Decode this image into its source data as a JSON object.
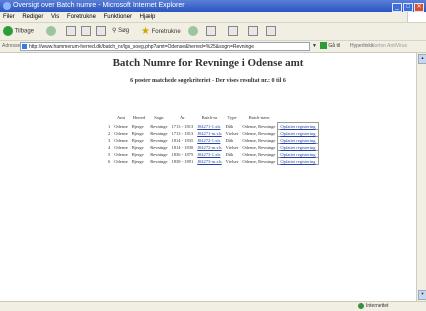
{
  "window": {
    "title": "Oversigt over Batch numre - Microsoft Internet Explorer",
    "buttons": {
      "minimize": "_",
      "maximize": "□",
      "close": "✕"
    }
  },
  "menubar": {
    "items": [
      "Filer",
      "Rediger",
      "Vis",
      "Foretrukne",
      "Funktioner",
      "Hjælp"
    ]
  },
  "toolbar": {
    "back_label": "Tilbage",
    "search_label": "Søg",
    "favorites_label": "Foretrukne"
  },
  "address": {
    "label": "Adresse",
    "url": "http://www.hammerum-herred.dk/batch_nr/lgs_soeg.php?amt=Odense&herred=%25&sogn=Revninge",
    "go_label": "Gå til",
    "links_label": "Hyperlinks",
    "norton_label": "Norton AntiVirus"
  },
  "page": {
    "heading": "Batch Numre for Revninge i Odense amt",
    "subheading": "6 poster matchede søgekriteriet - Der vises resultat nr.: 0 til 6"
  },
  "table": {
    "headers": [
      "",
      "Amt",
      "Herred",
      "Sogn",
      "År",
      "Batch-nr",
      "Type",
      "Batch-navn",
      ""
    ],
    "rows": [
      [
        "1",
        "Odense",
        "Bjerge",
        "Revninge",
        "1713 - 1813",
        "J04271-1.xls",
        "Dåb",
        "Odense, Revninge",
        "Opfattet registering"
      ],
      [
        "2",
        "Odense",
        "Bjerge",
        "Revninge",
        "1713 - 1813",
        "J04271-m.xls",
        "Vielser",
        "Odense, Revninge",
        "Opfattet registering"
      ],
      [
        "3",
        "Odense",
        "Bjerge",
        "Revninge",
        "1814 - 1835",
        "J04272-1.xls",
        "Dåb",
        "Odense, Revninge",
        "Opfattet registering"
      ],
      [
        "4",
        "Odense",
        "Bjerge",
        "Revninge",
        "1814 - 1830",
        "J04272-m.xls",
        "Vielser",
        "Odense, Revninge",
        "Opfattet registering"
      ],
      [
        "5",
        "Odense",
        "Bjerge",
        "Revninge",
        "1836 - 1875",
        "J04273-1.xls",
        "Dåb",
        "Odense, Revninge",
        "Opfattet registering"
      ],
      [
        "6",
        "Odense",
        "Bjerge",
        "Revninge",
        "1838 - 1891",
        "J04273-m.xls",
        "Vielser",
        "Odense, Revninge",
        "Opfattet registering"
      ]
    ]
  },
  "statusbar": {
    "left": "",
    "zone": "Internettet"
  },
  "colors": {
    "titlebar": "#2a55c2",
    "link": "#2244aa",
    "chrome": "#f1efe4"
  }
}
